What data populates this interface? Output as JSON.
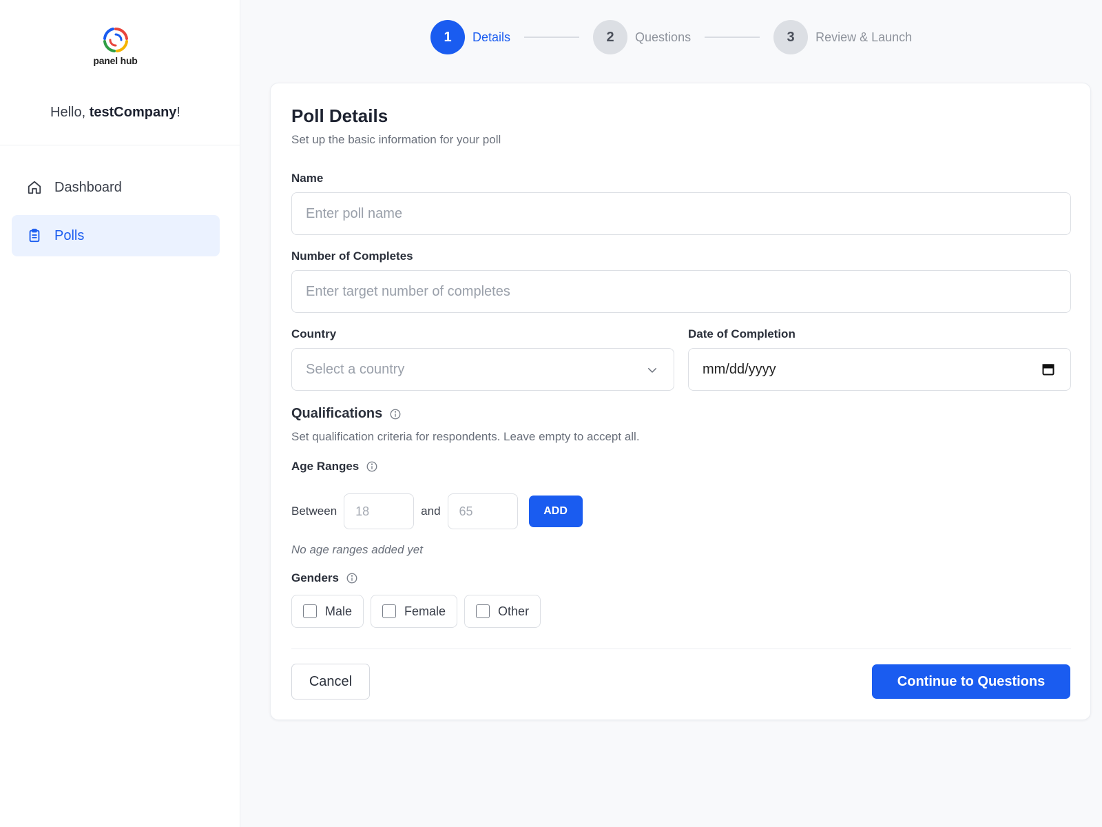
{
  "brand": {
    "name": "panel hub"
  },
  "sidebar": {
    "greeting_prefix": "Hello, ",
    "username": "testCompany",
    "greeting_suffix": "!",
    "items": [
      {
        "label": "Dashboard",
        "icon": "home-icon",
        "active": false
      },
      {
        "label": "Polls",
        "icon": "clipboard-icon",
        "active": true
      }
    ]
  },
  "stepper": {
    "steps": [
      {
        "number": "1",
        "label": "Details",
        "active": true
      },
      {
        "number": "2",
        "label": "Questions",
        "active": false
      },
      {
        "number": "3",
        "label": "Review & Launch",
        "active": false
      }
    ]
  },
  "form": {
    "title": "Poll Details",
    "subtitle": "Set up the basic information for your poll",
    "name": {
      "label": "Name",
      "placeholder": "Enter poll name"
    },
    "completes": {
      "label": "Number of Completes",
      "placeholder": "Enter target number of completes"
    },
    "country": {
      "label": "Country",
      "placeholder": "Select a country"
    },
    "date": {
      "label": "Date of Completion",
      "value": "mm/dd/yyyy"
    },
    "qualifications": {
      "title": "Qualifications",
      "description": "Set qualification criteria for respondents. Leave empty to accept all."
    },
    "age_ranges": {
      "title": "Age Ranges",
      "between_label": "Between",
      "and_label": "and",
      "min_placeholder": "18",
      "max_placeholder": "65",
      "add_label": "ADD",
      "empty_text": "No age ranges added yet"
    },
    "genders": {
      "title": "Genders",
      "options": [
        "Male",
        "Female",
        "Other"
      ]
    },
    "cancel_label": "Cancel",
    "continue_label": "Continue to Questions"
  },
  "colors": {
    "accent": "#1a5cf0",
    "active_nav_bg": "#ebf2ff",
    "inactive_step": "#dcdfe4"
  }
}
